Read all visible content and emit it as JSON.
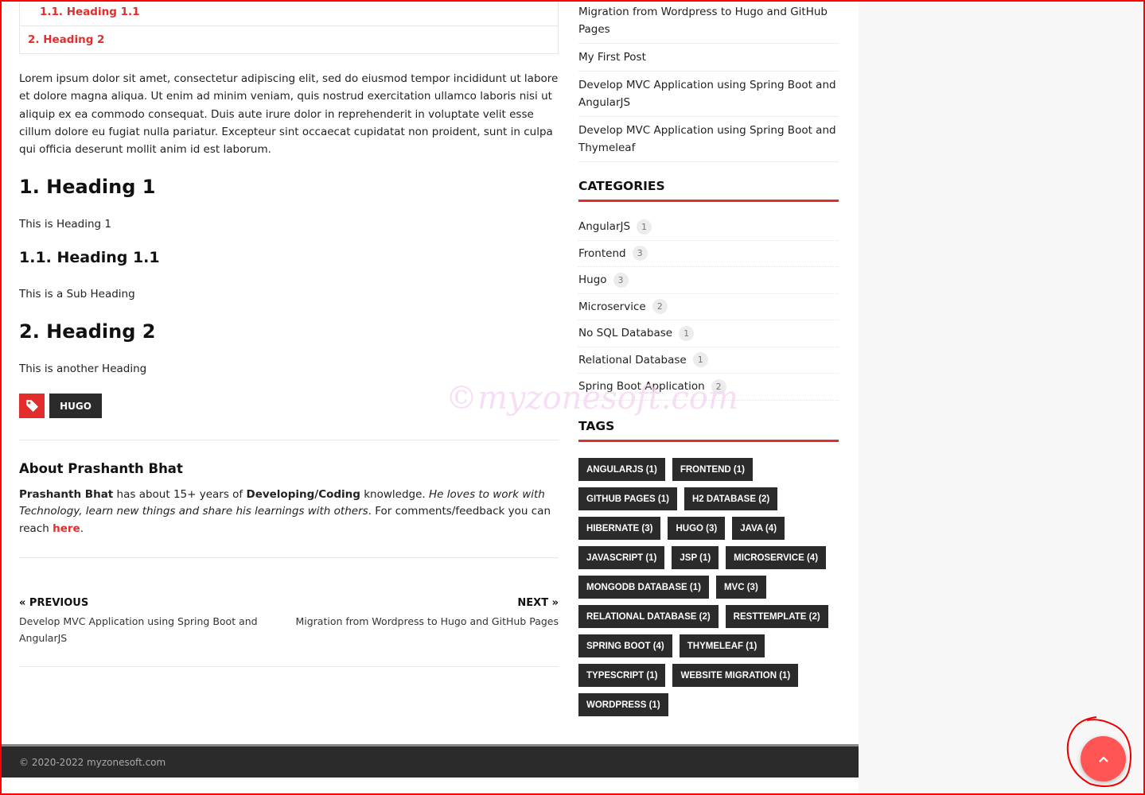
{
  "toc": {
    "items": [
      "1.1. Heading 1.1",
      "2. Heading 2"
    ]
  },
  "article": {
    "lorem": "Lorem ipsum dolor sit amet, consectetur adipiscing elit, sed do eiusmod tempor incididunt ut labore et dolore magna aliqua. Ut enim ad minim veniam, quis nostrud exercitation ullamco laboris nisi ut aliquip ex ea commodo consequat. Duis aute irure dolor in reprehenderit in voluptate velit esse cillum dolore eu fugiat nulla pariatur. Excepteur sint occaecat cupidatat non proident, sunt in culpa qui officia deserunt mollit anim id est laborum.",
    "h1": "1. Heading 1",
    "h1_text": "This is Heading 1",
    "h11": "1.1. Heading 1.1",
    "h11_text": "This is a Sub Heading",
    "h2": "2. Heading 2",
    "h2_text": "This is another Heading",
    "tag": "HUGO"
  },
  "author": {
    "title": "About Prashanth Bhat",
    "name": "Prashanth Bhat",
    "t1": " has about 15+ years of ",
    "skill": "Developing/Coding",
    "t2": " knowledge. ",
    "italic": "He loves to work with Technology, learn new things and share his learnings with others",
    "t3": ". For comments/feedback you can reach ",
    "link": "here",
    "t4": "."
  },
  "nav": {
    "prev_label": "« PREVIOUS",
    "prev_title": "Develop MVC Application using Spring Boot and AngularJS",
    "next_label": "NEXT »",
    "next_title": "Migration from Wordpress to Hugo and GitHub Pages"
  },
  "sidebar": {
    "recent_posts": [
      "Migration from Wordpress to Hugo and GitHub Pages",
      "My First Post",
      "Develop MVC Application using Spring Boot and AngularJS",
      "Develop MVC Application using Spring Boot and Thymeleaf"
    ],
    "categories_title": "CATEGORIES",
    "categories": [
      {
        "name": "AngularJS",
        "count": "1"
      },
      {
        "name": "Frontend",
        "count": "3"
      },
      {
        "name": "Hugo",
        "count": "3"
      },
      {
        "name": "Microservice",
        "count": "2"
      },
      {
        "name": "No SQL Database",
        "count": "1"
      },
      {
        "name": "Relational Database",
        "count": "1"
      },
      {
        "name": "Spring Boot Application",
        "count": "2"
      }
    ],
    "tags_title": "TAGS",
    "tags": [
      "ANGULARJS (1)",
      "FRONTEND (1)",
      "GITHUB PAGES (1)",
      "H2 DATABASE (2)",
      "HIBERNATE (3)",
      "HUGO (3)",
      "JAVA (4)",
      "JAVASCRIPT (1)",
      "JSP (1)",
      "MICROSERVICE (4)",
      "MONGODB DATABASE (1)",
      "MVC (3)",
      "RELATIONAL DATABASE (2)",
      "RESTTEMPLATE (2)",
      "SPRING BOOT (4)",
      "THYMELEAF (1)",
      "TYPESCRIPT (1)",
      "WEBSITE MIGRATION (1)",
      "WORDPRESS (1)"
    ]
  },
  "watermark": "©myzonesoft.com",
  "footer": {
    "copyright": "© 2020-2022 myzonesoft.com"
  },
  "colors": {
    "accent": "#e32d2d",
    "dark": "#2b2b2b",
    "scroll_top": "#ff5555"
  },
  "icons": {
    "tag": "tag-icon",
    "scroll_top": "chevron-up-icon"
  }
}
